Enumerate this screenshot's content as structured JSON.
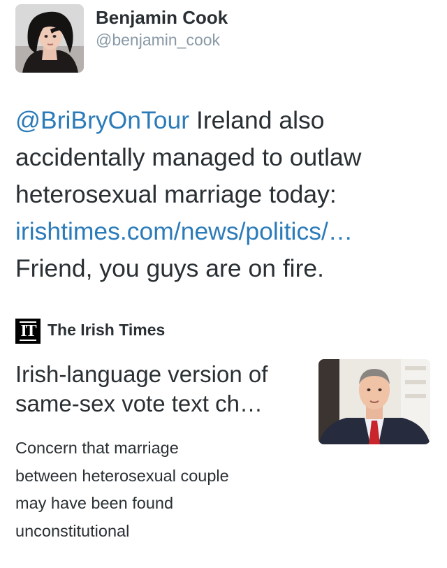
{
  "tweet": {
    "user": {
      "name": "Benjamin Cook",
      "handle": "@benjamin_cook",
      "avatar_icon": "user-avatar"
    },
    "text_lines": [
      {
        "mention": "@BriBryOnTour",
        "text": " Ireland also"
      },
      {
        "text": "accidentally managed to outlaw"
      },
      {
        "text": "heterosexual marriage today:"
      },
      {
        "link": "irishtimes.com/news/politics/…"
      },
      {
        "text": "Friend, you guys are on fire."
      }
    ],
    "colors": {
      "link": "#2b7bb9",
      "text": "#292f33",
      "handle": "#8899a6"
    }
  },
  "card": {
    "source": {
      "logo_text": "IT",
      "name": "The Irish Times"
    },
    "title_lines": [
      "Irish-language version of",
      "same-sex vote text ch…"
    ],
    "description_lines": [
      "Concern that marriage",
      "between heterosexual couple",
      "may have been found",
      "unconstitutional"
    ],
    "image_icon": "news-photo"
  }
}
